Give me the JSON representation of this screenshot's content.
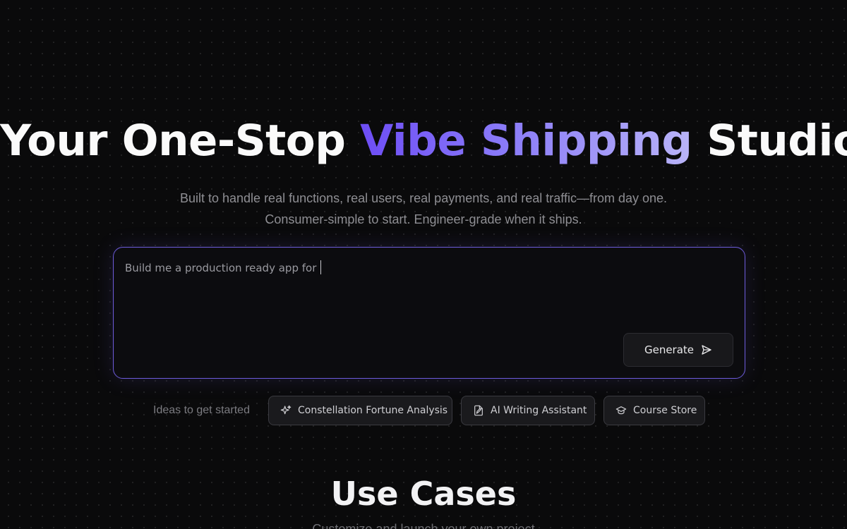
{
  "hero": {
    "title_before": "Your One-Stop ",
    "title_accent": "Vibe Shipping",
    "title_after": " Studio",
    "subtitle_line1": "Built to handle real functions, real users, real payments, and real traffic—from day one.",
    "subtitle_line2": "Consumer-simple to start. Engineer-grade when it ships."
  },
  "prompt": {
    "value": "Build me a production ready app for",
    "generate_label": "Generate",
    "generate_icon": "send-icon"
  },
  "ideas": {
    "label": "Ideas to get started",
    "chips": [
      {
        "label": "Constellation Fortune Analysis",
        "icon": "sparkles-icon"
      },
      {
        "label": "AI Writing Assistant",
        "icon": "file-edit-icon"
      },
      {
        "label": "Course Store",
        "icon": "graduation-cap-icon"
      }
    ]
  },
  "use_cases": {
    "title": "Use Cases",
    "subtitle": "Customize and launch your own project"
  },
  "colors": {
    "background": "#0a0a0b",
    "accent_start": "#6d4df5",
    "accent_end": "#b9b4f8",
    "prompt_border": "#6b5ad6"
  }
}
